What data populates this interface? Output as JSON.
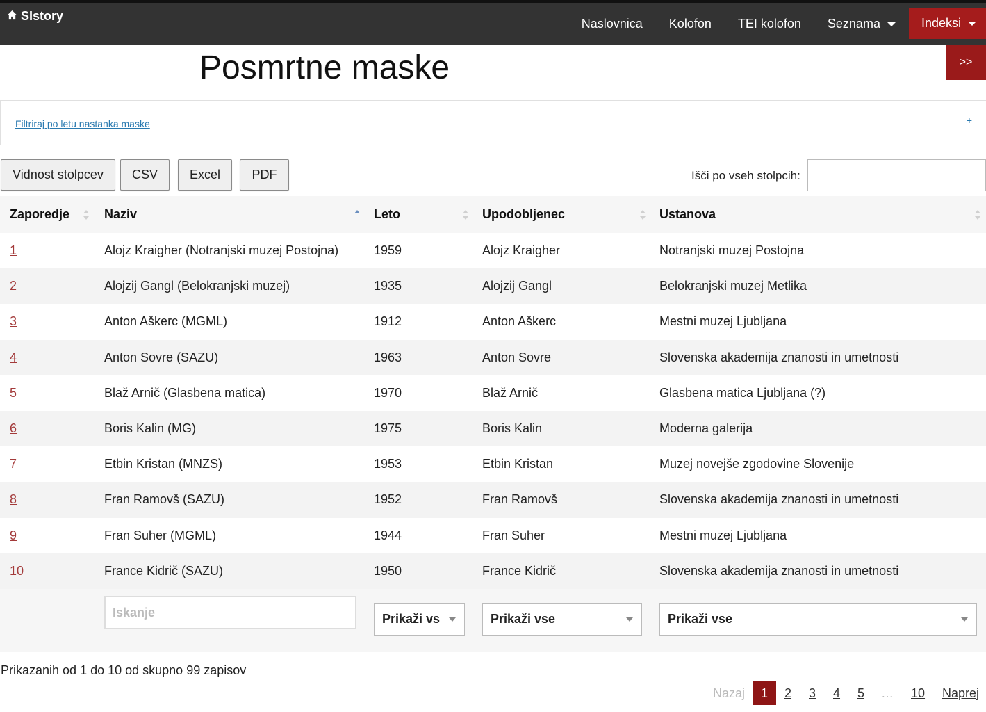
{
  "brand": {
    "name": "SIstory",
    "icon": "home-icon"
  },
  "nav": {
    "items": [
      {
        "label": "Naslovnica"
      },
      {
        "label": "Kolofon"
      },
      {
        "label": "TEI kolofon"
      },
      {
        "label": "Seznama"
      },
      {
        "label": "Indeksi"
      }
    ]
  },
  "colors": {
    "topbar": "#333333",
    "accent": "#a51c1c",
    "link": "#a33a3a",
    "filter_link": "#2a7ab0"
  },
  "page": {
    "title": "Posmrtne maske",
    "expand_label": ">>"
  },
  "filter": {
    "label": "Filtriraj po letu nastanka maske",
    "toggle": "+"
  },
  "toolbar": {
    "visibility": "Vidnost stolpcev",
    "csv": "CSV",
    "excel": "Excel",
    "pdf": "PDF",
    "search_label": "Išči po vseh stolpcih:",
    "search_value": ""
  },
  "table": {
    "columns": [
      "Zaporedje",
      "Naziv",
      "Leto",
      "Upodobljenec",
      "Ustanova"
    ],
    "sorted_column": "Naziv",
    "sort_direction": "ascending",
    "rows": [
      [
        "1",
        "Alojz Kraigher (Notranjski muzej Postojna)",
        "1959",
        "Alojz Kraigher",
        "Notranjski muzej Postojna"
      ],
      [
        "2",
        "Alojzij Gangl (Belokranjski muzej)",
        "1935",
        "Alojzij Gangl",
        "Belokranjski muzej Metlika"
      ],
      [
        "3",
        "Anton Aškerc (MGML)",
        "1912",
        "Anton Aškerc",
        "Mestni muzej Ljubljana"
      ],
      [
        "4",
        "Anton Sovre (SAZU)",
        "1963",
        "Anton Sovre",
        "Slovenska akademija znanosti in umetnosti"
      ],
      [
        "5",
        "Blaž Arnič (Glasbena matica)",
        "1970",
        "Blaž Arnič",
        "Glasbena matica Ljubljana (?)"
      ],
      [
        "6",
        "Boris Kalin (MG)",
        "1975",
        "Boris Kalin",
        "Moderna galerija"
      ],
      [
        "7",
        "Etbin Kristan (MNZS)",
        "1953",
        "Etbin Kristan",
        "Muzej novejše zgodovine Slovenije"
      ],
      [
        "8",
        "Fran Ramovš (SAZU)",
        "1952",
        "Fran Ramovš",
        "Slovenska akademija znanosti in umetnosti"
      ],
      [
        "9",
        "Fran Suher (MGML)",
        "1944",
        "Fran Suher",
        "Mestni muzej Ljubljana"
      ],
      [
        "10",
        "France Kidrič (SAZU)",
        "1950",
        "France Kidrič",
        "Slovenska akademija znanosti in umetnosti"
      ]
    ],
    "footer": {
      "search_placeholder": "Iskanje",
      "leto_select": "Prikaži vs",
      "upodobljenec_select": "Prikaži vse",
      "ustanova_select": "Prikaži vse"
    }
  },
  "info": "Prikazanih od 1 do 10 od skupno 99 zapisov",
  "pagination": {
    "previous": "Nazaj",
    "pages": [
      "1",
      "2",
      "3",
      "4",
      "5"
    ],
    "ellipsis": "…",
    "last": "10",
    "next": "Naprej",
    "current": "1"
  }
}
